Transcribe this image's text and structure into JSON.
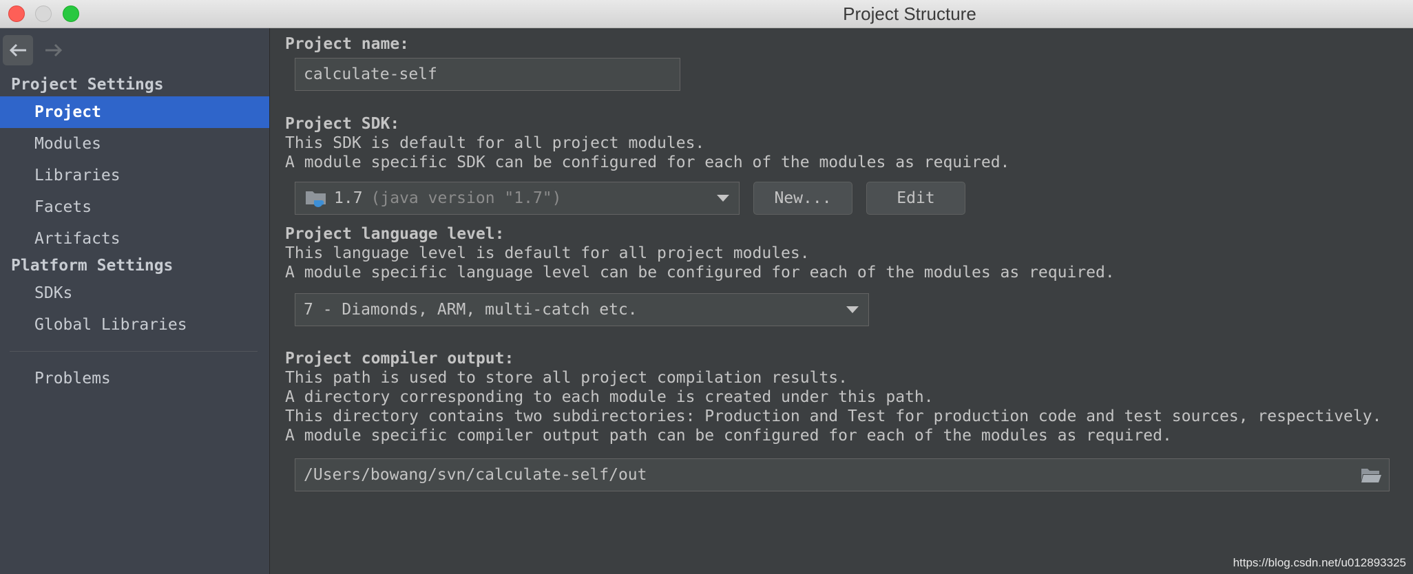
{
  "window": {
    "title": "Project Structure"
  },
  "colors": {
    "sidebar_bg": "#3e434c",
    "selection": "#2f65ca",
    "panel_bg": "#3c3f41"
  },
  "sidebar": {
    "project_settings_heading": "Project Settings",
    "project_items": [
      {
        "label": "Project",
        "selected": true
      },
      {
        "label": "Modules",
        "selected": false
      },
      {
        "label": "Libraries",
        "selected": false
      },
      {
        "label": "Facets",
        "selected": false
      },
      {
        "label": "Artifacts",
        "selected": false
      }
    ],
    "platform_settings_heading": "Platform Settings",
    "platform_items": [
      {
        "label": "SDKs"
      },
      {
        "label": "Global Libraries"
      }
    ],
    "problems_label": "Problems"
  },
  "main": {
    "project_name": {
      "label": "Project name:",
      "value": "calculate-self"
    },
    "sdk": {
      "label": "Project SDK:",
      "desc1": "This SDK is default for all project modules.",
      "desc2": "A module specific SDK can be configured for each of the modules as required.",
      "selected_version": "1.7",
      "selected_desc": "(java version \"1.7\")",
      "new_button": "New...",
      "edit_button": "Edit"
    },
    "language_level": {
      "label": "Project language level:",
      "desc1": "This language level is default for all project modules.",
      "desc2": "A module specific language level can be configured for each of the modules as required.",
      "selected": "7 - Diamonds, ARM, multi-catch etc."
    },
    "compiler_output": {
      "label": "Project compiler output:",
      "desc1": "This path is used to store all project compilation results.",
      "desc2": "A directory corresponding to each module is created under this path.",
      "desc3": "This directory contains two subdirectories: Production and Test for production code and test sources, respectively.",
      "desc4": "A module specific compiler output path can be configured for each of the modules as required.",
      "path": "/Users/bowang/svn/calculate-self/out"
    }
  },
  "watermark": "https://blog.csdn.net/u012893325"
}
